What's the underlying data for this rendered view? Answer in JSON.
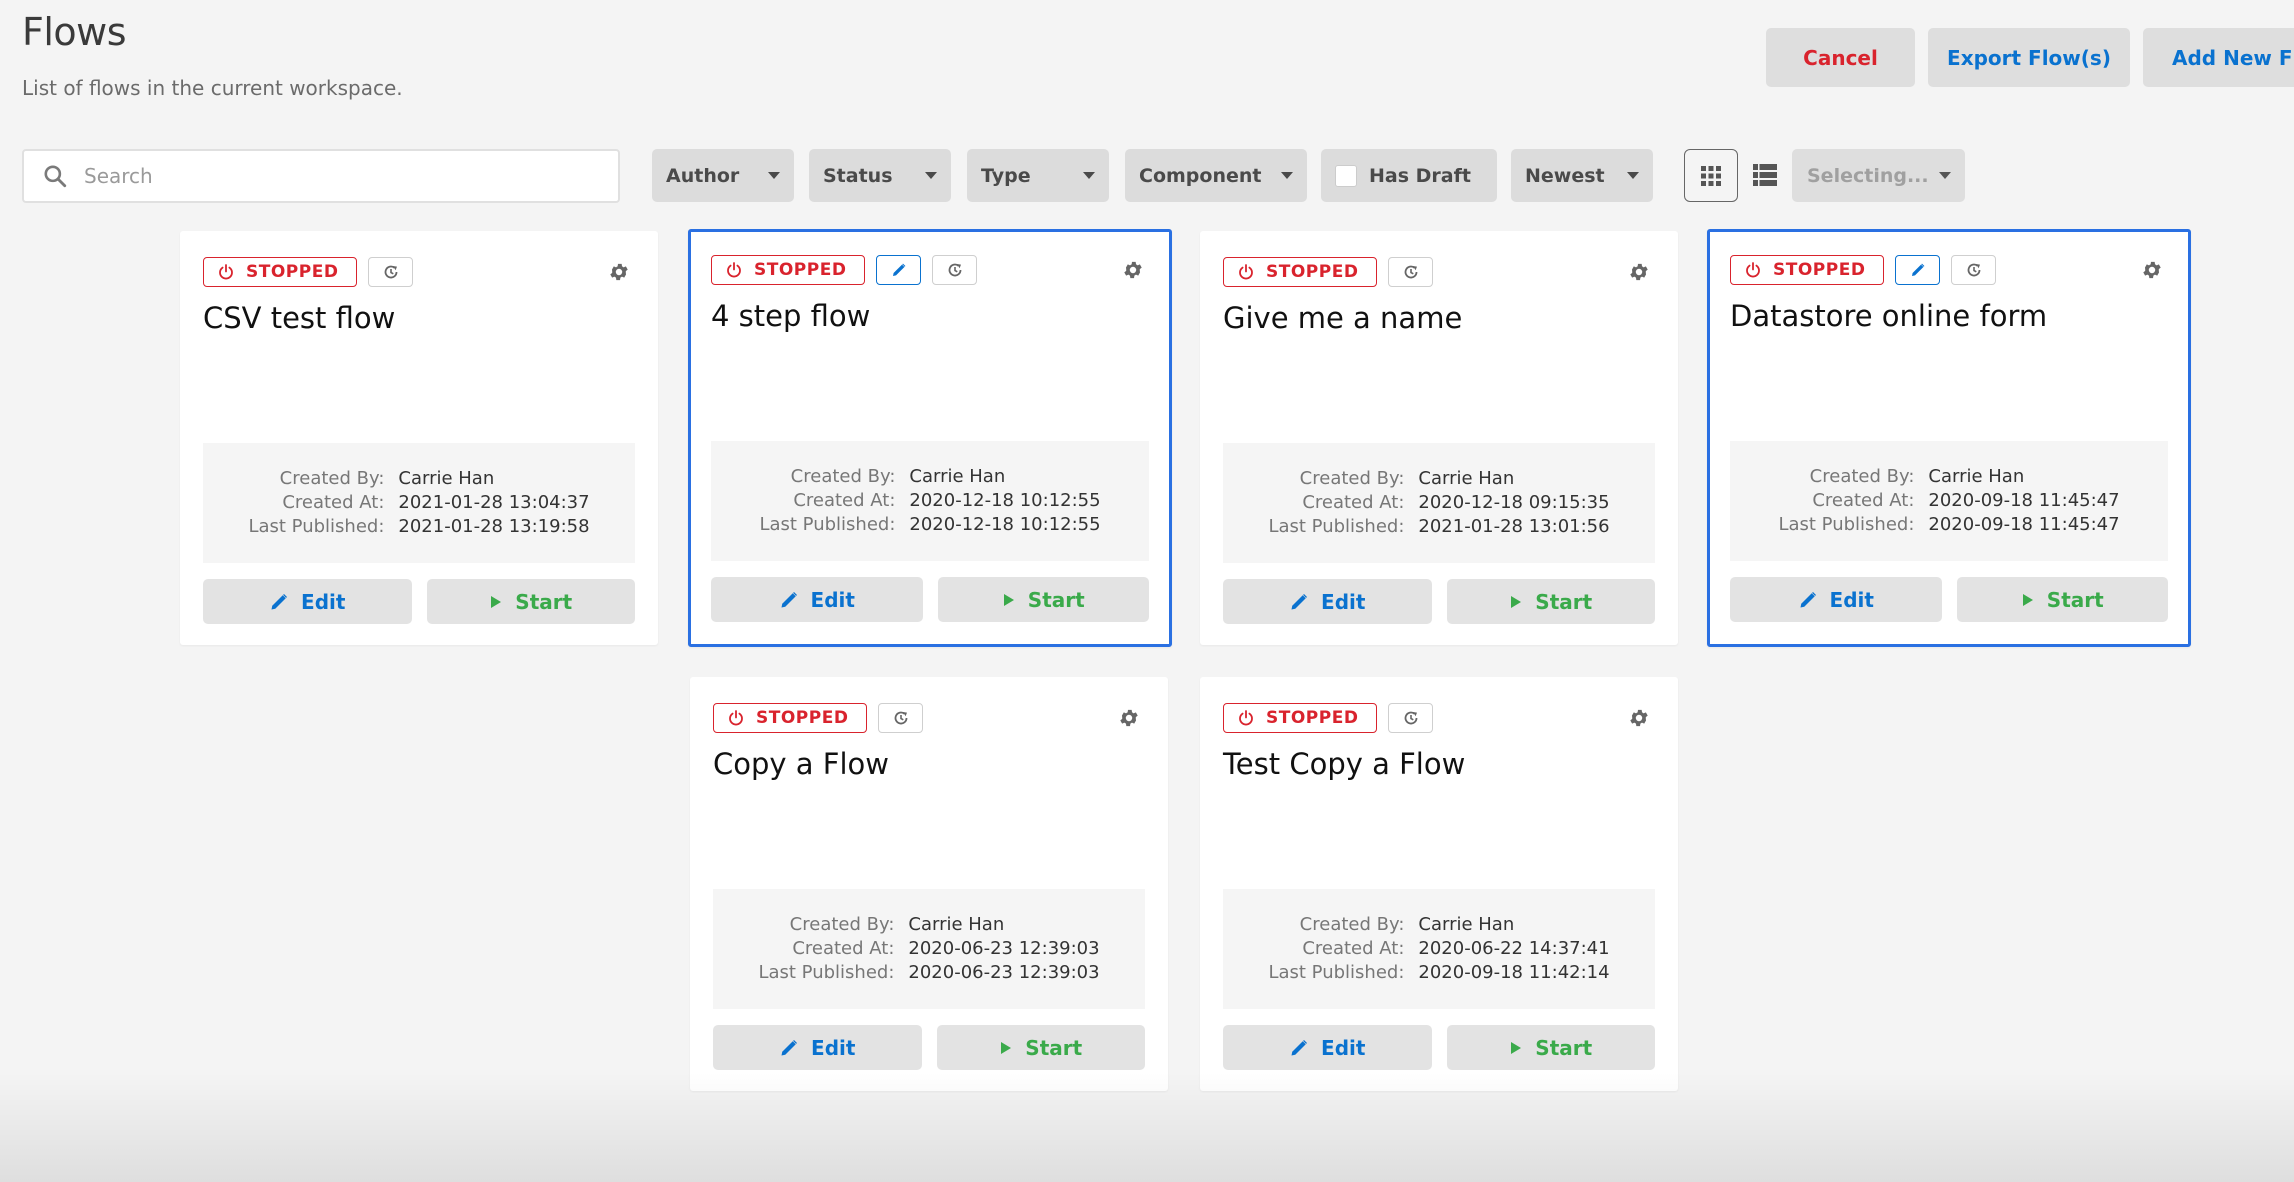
{
  "header": {
    "title": "Flows",
    "subtitle": "List of flows in the current workspace."
  },
  "actions": {
    "cancel_label": "Cancel",
    "export_label": "Export Flow(s)",
    "add_label": "Add New Flow"
  },
  "toolbar": {
    "search_placeholder": "Search",
    "search_value": "",
    "filters": {
      "author": "Author",
      "status": "Status",
      "type": "Type",
      "component": "Component",
      "has_draft": "Has Draft",
      "sort": "Newest"
    },
    "has_draft_checked": false,
    "view_mode": "grid",
    "selecting_label": "Selecting..."
  },
  "labels": {
    "created_by": "Created By:",
    "created_at": "Created At:",
    "last_published": "Last Published:",
    "edit": "Edit",
    "start": "Start"
  },
  "colors": {
    "accent": "#0a72cf",
    "danger": "#d9232d",
    "success": "#3aaa4a",
    "selected_border": "#2a70e2"
  },
  "flows": [
    {
      "name": "CSV test flow",
      "status": "STOPPED",
      "has_draft": false,
      "selected": false,
      "created_by": "Carrie Han",
      "created_at": "2021-01-28 13:04:37",
      "last_published": "2021-01-28 13:19:58"
    },
    {
      "name": "4 step flow",
      "status": "STOPPED",
      "has_draft": true,
      "selected": true,
      "created_by": "Carrie Han",
      "created_at": "2020-12-18 10:12:55",
      "last_published": "2020-12-18 10:12:55"
    },
    {
      "name": "Give me a name",
      "status": "STOPPED",
      "has_draft": false,
      "selected": false,
      "created_by": "Carrie Han",
      "created_at": "2020-12-18 09:15:35",
      "last_published": "2021-01-28 13:01:56"
    },
    {
      "name": "Datastore online form",
      "status": "STOPPED",
      "has_draft": true,
      "selected": true,
      "created_by": "Carrie Han",
      "created_at": "2020-09-18 11:45:47",
      "last_published": "2020-09-18 11:45:47"
    },
    {
      "name": "Copy a Flow",
      "status": "STOPPED",
      "has_draft": false,
      "selected": false,
      "created_by": "Carrie Han",
      "created_at": "2020-06-23 12:39:03",
      "last_published": "2020-06-23 12:39:03"
    },
    {
      "name": "Test Copy a Flow",
      "status": "STOPPED",
      "has_draft": false,
      "selected": false,
      "created_by": "Carrie Han",
      "created_at": "2020-06-22 14:37:41",
      "last_published": "2020-09-18 11:42:14"
    }
  ]
}
